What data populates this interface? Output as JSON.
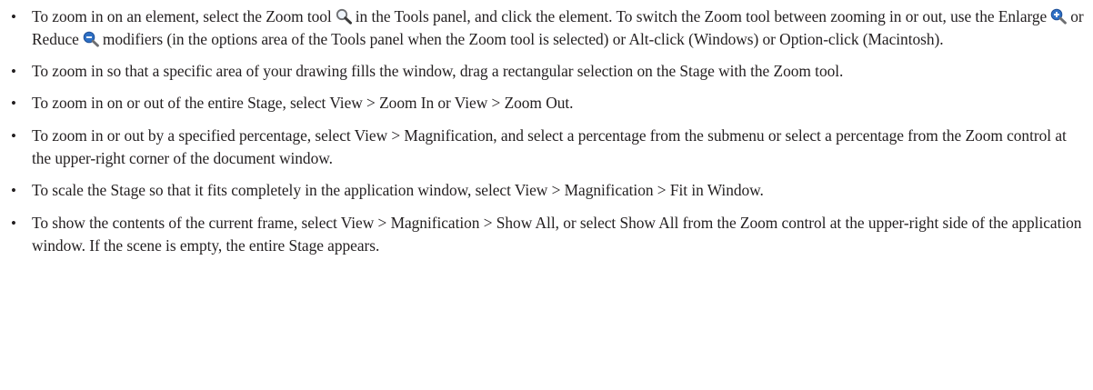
{
  "bullet_char": "•",
  "items": [
    {
      "segments": [
        "To zoom in on an element, select the Zoom tool",
        "in the Tools panel, and click the element. To switch the Zoom tool between zooming in or out, use the Enlarge",
        "or Reduce",
        "modifiers (in the options area of the Tools panel when the Zoom tool is selected) or Alt-click (Windows) or Option-click (Macintosh)."
      ],
      "icons": [
        "zoom-tool-icon",
        "enlarge-icon",
        "reduce-icon"
      ]
    },
    {
      "text": "To zoom in so that a specific area of your drawing fills the window, drag a rectangular selection on the Stage with the Zoom tool."
    },
    {
      "text": "To zoom in on or out of the entire Stage, select View > Zoom In or View > Zoom Out."
    },
    {
      "text": "To zoom in or out by a specified percentage, select View > Magnification, and select a percentage from the submenu or select a percentage from the Zoom control at the upper-right corner of the document window."
    },
    {
      "text": "To scale the Stage so that it fits completely in the application window, select View > Magnification > Fit in Window."
    },
    {
      "text": "To show the contents of the current frame, select View > Magnification > Show All, or select Show All from the Zoom control at the upper-right side of the application window. If the scene is empty, the entire Stage appears."
    }
  ],
  "colors": {
    "text": "#231f20",
    "icon_blue": "#2d6fc4",
    "icon_gray": "#6d6e71"
  }
}
